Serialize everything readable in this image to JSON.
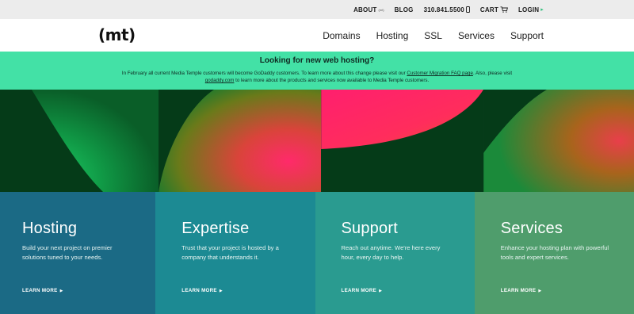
{
  "utility_nav": {
    "about": "ABOUT",
    "about_sup": "(mt)",
    "blog": "BLOG",
    "phone": "310.841.5500",
    "phone_icon": "mobile-phone-icon",
    "cart": "CART",
    "cart_icon": "shopping-cart-icon",
    "login": "LOGIN",
    "login_arrow": "▸"
  },
  "header": {
    "logo": "(mt)",
    "nav": [
      "Domains",
      "Hosting",
      "SSL",
      "Services",
      "Support"
    ]
  },
  "banner": {
    "title": "Looking for new web hosting?",
    "text_1": "In February all current Media Temple customers will become GoDaddy customers. To learn more about this change please visit our ",
    "link_1": "Customer Migration FAQ page",
    "text_2": ". Also, please visit ",
    "link_2": "godaddy.com",
    "text_3": " to learn more about the products and services now available to Media Temple customers.",
    "background": "#43e1a6"
  },
  "tiles": [
    {
      "title": "Hosting",
      "text": "Build your next project on premier solutions tuned to your needs.",
      "more": "LEARN MORE",
      "color": "#1b6a85"
    },
    {
      "title": "Expertise",
      "text": "Trust that your project is hosted by a company that understands it.",
      "more": "LEARN MORE",
      "color": "#1c8a93"
    },
    {
      "title": "Support",
      "text": "Reach out anytime. We're here every hour, every day to help.",
      "more": "LEARN MORE",
      "color": "#2a9b90"
    },
    {
      "title": "Services",
      "text": "Enhance your hosting plan with powerful tools and expert services.",
      "more": "LEARN MORE",
      "color": "#4f9d6c"
    }
  ],
  "colors": {
    "art_dark": "#053b18",
    "art_green": "#14b25a",
    "art_red": "#e83a5a",
    "art_pink": "#ff1f6e",
    "art_orange": "#e85a2a"
  }
}
